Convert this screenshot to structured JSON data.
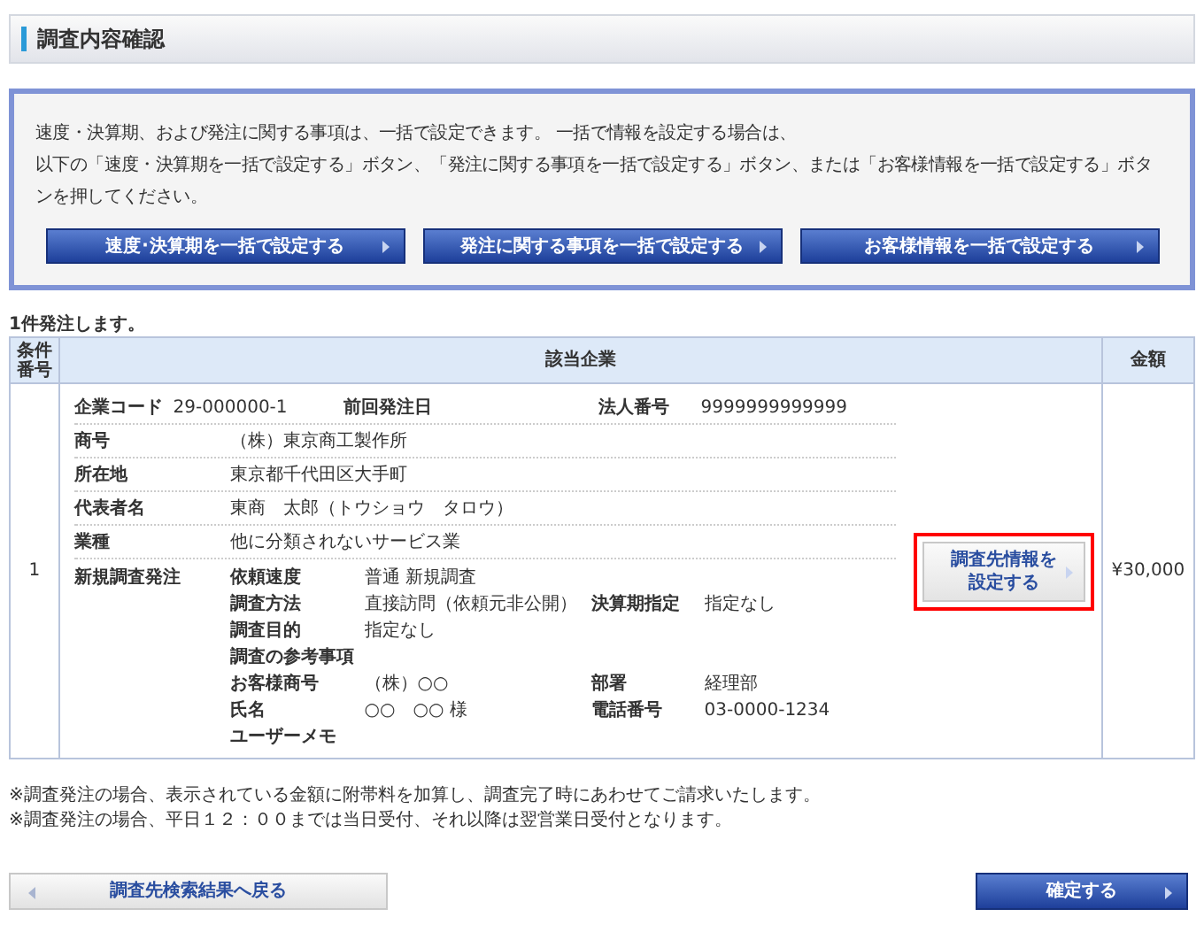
{
  "page_title": "調査内容確認",
  "info": {
    "lines": [
      "速度・決算期、および発注に関する事項は、一括で設定できます。 一括で情報を設定する場合は、",
      "以下の「速度・決算期を一括で設定する」ボタン、「発注に関する事項を一括で設定する」ボタン、または「お客様情報を一括で設定する」ボタンを押してください。"
    ],
    "buttons": [
      "速度･決算期を一括で設定する",
      "発注に関する事項を一括で設定する",
      "お客様情報を一括で設定する"
    ]
  },
  "order_count": "1件発注します。",
  "table": {
    "columns": [
      "条件番号",
      "該当企業",
      "金額"
    ],
    "rows": [
      {
        "number": "1",
        "amount": "¥30,000",
        "company": {
          "code_label": "企業コード",
          "code": "29-000000-1",
          "last_order_label": "前回発注日",
          "corp_number_label": "法人番号",
          "corp_number": "9999999999999",
          "fields": [
            {
              "label": "商号",
              "value": "（株）東京商工製作所"
            },
            {
              "label": "所在地",
              "value": "東京都千代田区大手町"
            },
            {
              "label": "代表者名",
              "value": "東商　太郎（トウショウ　タロウ）"
            },
            {
              "label": "業種",
              "value": "他に分類されないサービス業"
            }
          ]
        },
        "order": {
          "label": "新規調査発注",
          "items": [
            {
              "label": "依頼速度",
              "value": "普通 新規調査"
            },
            {
              "label": "調査方法",
              "value": "直接訪問（依頼元非公開）",
              "label2": "決算期指定",
              "value2": "指定なし"
            },
            {
              "label": "調査目的",
              "value": "指定なし"
            },
            {
              "label": "調査の参考事項"
            },
            {
              "label": "お客様商号",
              "value": "（株）○○",
              "label2": "部署",
              "value2": "経理部"
            },
            {
              "label": "氏名",
              "value": "○○　○○ 様",
              "label2": "電話番号",
              "value2": "03-0000-1234"
            },
            {
              "label": "ユーザーメモ"
            }
          ]
        },
        "action": {
          "lines": [
            "調査先情報を",
            "設定する"
          ],
          "highlighted": true
        }
      }
    ]
  },
  "notes": [
    "※調査発注の場合、表示されている金額に附帯料を加算し、調査完了時にあわせてご請求いたします。",
    "※調査発注の場合、平日１２：００までは当日受付、それ以降は翌営業日受付となります。"
  ],
  "footer": {
    "back_button": "調査先検索結果へ戻る",
    "confirm_button": "確定する"
  }
}
